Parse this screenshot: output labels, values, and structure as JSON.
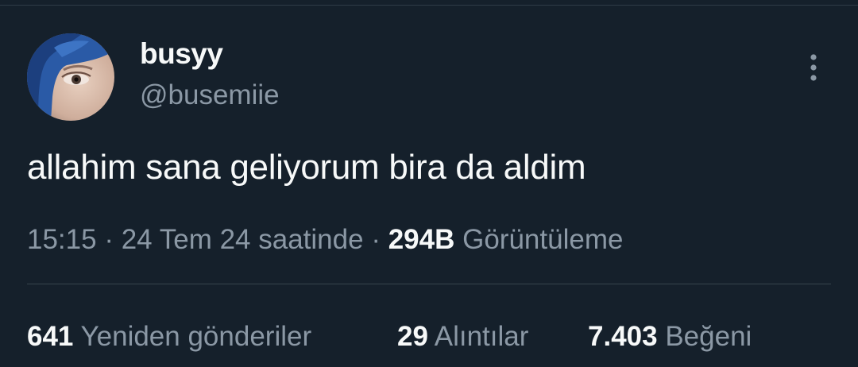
{
  "user": {
    "display_name": "busyy",
    "handle": "@busemiie",
    "avatar_icon": "profile-photo"
  },
  "tweet": {
    "text": "allahim sana geliyorum bira da aldim"
  },
  "meta": {
    "time": "15:15",
    "separator": "·",
    "date": "24 Tem 24 saatinde",
    "views_count": "294B",
    "views_label": "Görüntüleme"
  },
  "stats": {
    "retweets_count": "641",
    "retweets_label": "Yeniden gönderiler",
    "quotes_count": "29",
    "quotes_label": "Alıntılar",
    "likes_count": "7.403",
    "likes_label": "Beğeni"
  },
  "colors": {
    "background": "#15202b",
    "primary_text": "#f7f9f9",
    "secondary_text": "#8b98a5",
    "divider": "#38444d"
  },
  "icons": {
    "more": "more-vertical-icon"
  }
}
